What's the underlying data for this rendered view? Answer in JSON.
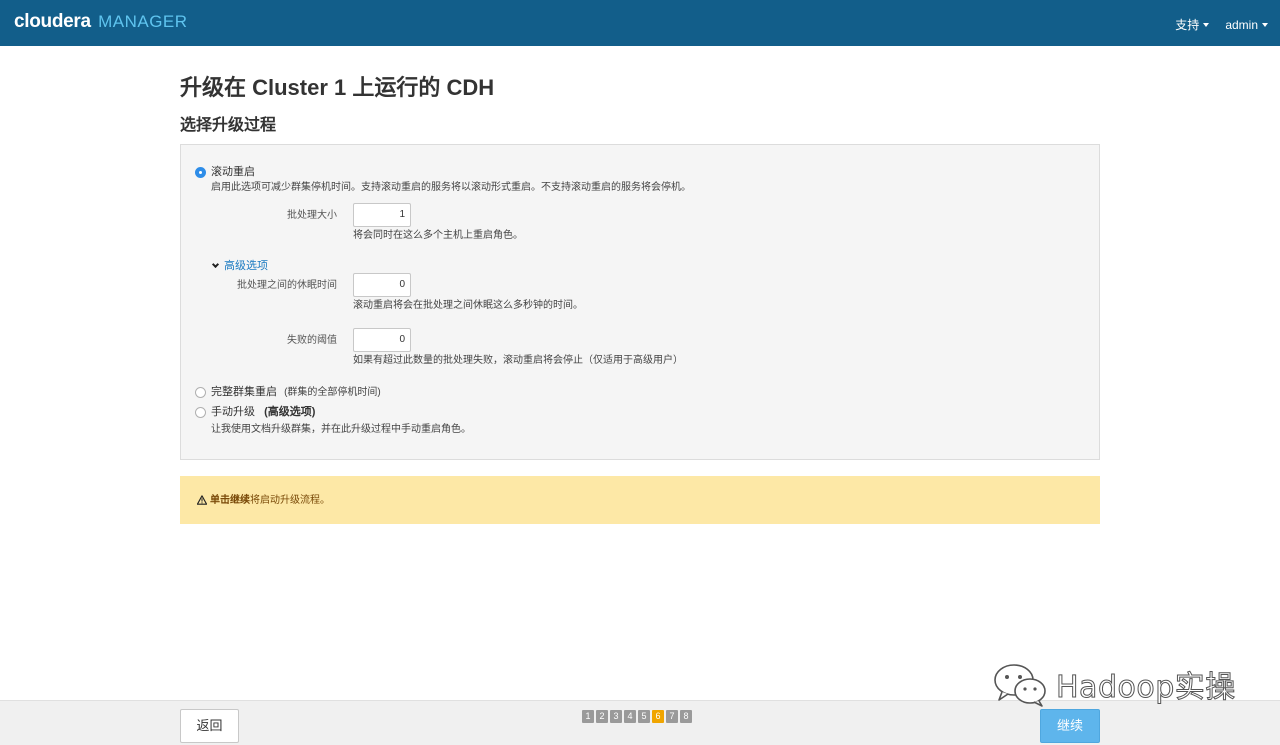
{
  "header": {
    "brand": "cloudera",
    "product": "MANAGER",
    "nav": [
      "支持",
      "admin"
    ]
  },
  "page_title": "升级在 Cluster 1 上运行的 CDH",
  "section_title": "选择升级过程",
  "rolling_restart": {
    "label": "滚动重启",
    "description": "启用此选项可减少群集停机时间。支持滚动重启的服务将以滚动形式重启。不支持滚动重启的服务将会停机。",
    "batch_size_label": "批处理大小",
    "batch_size_value": "1",
    "batch_size_hint": "将会同时在这么多个主机上重启角色。",
    "advanced_toggle": "高级选项",
    "sleep_label": "批处理之间的休眠时间",
    "sleep_value": "0",
    "sleep_hint": "滚动重启将会在批处理之间休眠这么多秒钟的时间。",
    "failure_label": "失败的阈值",
    "failure_value": "0",
    "failure_hint": "如果有超过此数量的批处理失败，滚动重启将会停止（仅适用于高级用户）"
  },
  "full_restart": {
    "label": "完整群集重启",
    "note": "(群集的全部停机时间)"
  },
  "manual": {
    "label": "手动升级",
    "note": "(高级选项)",
    "description": "让我使用文档升级群集，并在此升级过程中手动重启角色。"
  },
  "alert": {
    "bold": "单击继续",
    "text": "将启动升级流程。"
  },
  "footer": {
    "back_label": "返回",
    "continue_label": "继续",
    "steps": [
      "1",
      "2",
      "3",
      "4",
      "5",
      "6",
      "7",
      "8"
    ],
    "active_step": 6
  },
  "watermark": "Hadoop实操",
  "colors": {
    "header_bg": "#125e8a",
    "accent": "#2e8de8",
    "alert_bg": "#fde8a6",
    "step_active": "#f0a500",
    "continue_bg": "#5eb5ec"
  }
}
